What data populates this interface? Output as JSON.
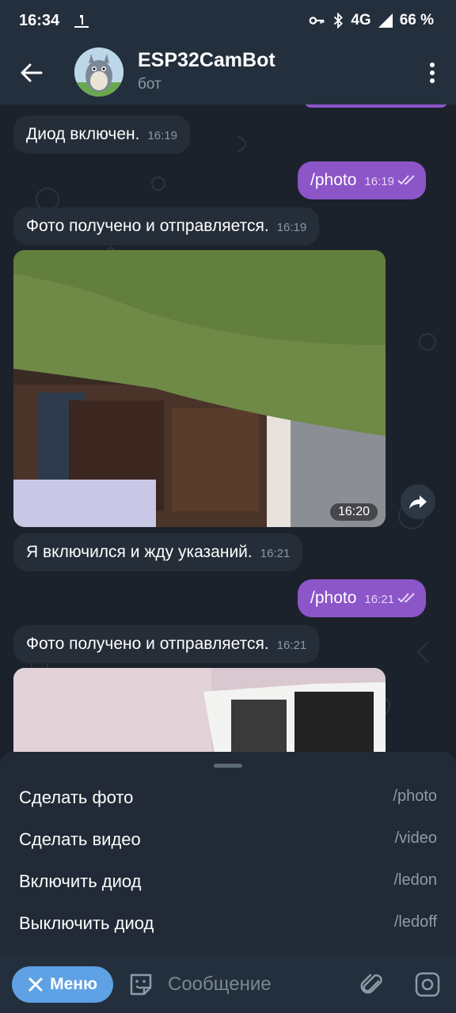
{
  "status_bar": {
    "time": "16:34",
    "network": "4G",
    "battery": "66 %"
  },
  "header": {
    "title": "ESP32CamBot",
    "subtitle": "бот"
  },
  "messages": [
    {
      "type": "in",
      "text": "Диод включен.",
      "time": "16:19"
    },
    {
      "type": "out",
      "text": "/photo",
      "time": "16:19"
    },
    {
      "type": "in",
      "text": "Фото получено и отправляется.",
      "time": "16:19"
    },
    {
      "type": "photo",
      "time": "16:20"
    },
    {
      "type": "in",
      "text": "Я включился и жду указаний.",
      "time": "16:21"
    },
    {
      "type": "out",
      "text": "/photo",
      "time": "16:21"
    },
    {
      "type": "in",
      "text": "Фото получено и отправляется.",
      "time": "16:21"
    }
  ],
  "commands": [
    {
      "label": "Сделать фото",
      "command": "/photo"
    },
    {
      "label": "Сделать видео",
      "command": "/video"
    },
    {
      "label": "Включить диод",
      "command": "/ledon"
    },
    {
      "label": "Выключить диод",
      "command": "/ledoff"
    }
  ],
  "input_bar": {
    "menu_label": "Меню",
    "placeholder": "Сообщение"
  },
  "colors": {
    "accent": "#5ea1e4",
    "outgoing_bubble": "#8c55c8",
    "incoming_bubble": "#252d38",
    "header_bg": "#242f3d"
  },
  "icons": [
    "back-arrow-icon",
    "more-vert-icon",
    "key-icon",
    "bluetooth-icon",
    "signal-icon",
    "forward-icon",
    "close-icon",
    "sticker-icon",
    "attach-icon",
    "camera-icon",
    "double-check-icon"
  ]
}
